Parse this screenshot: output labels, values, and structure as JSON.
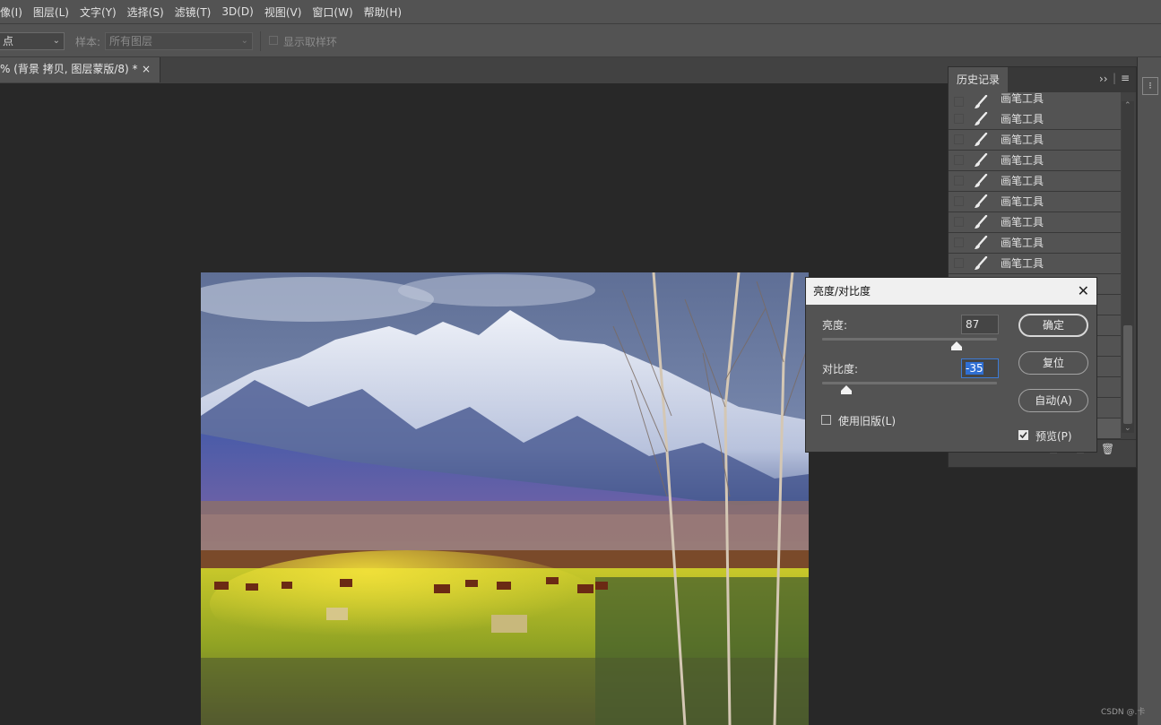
{
  "menu": [
    "像(I)",
    "图层(L)",
    "文字(Y)",
    "选择(S)",
    "滤镜(T)",
    "3D(D)",
    "视图(V)",
    "窗口(W)",
    "帮助(H)"
  ],
  "options": {
    "sample_size_value": "点",
    "sample_label": "样本:",
    "sample_value": "所有图层",
    "show_ring_label": "显示取样环"
  },
  "doc_tab": {
    "title": "% (背景 拷贝, 图层蒙版/8) *",
    "close": "×"
  },
  "history": {
    "tab": "历史记录",
    "items": [
      "画笔工具",
      "画笔工具",
      "画笔工具",
      "画笔工具",
      "画笔工具",
      "画笔工具",
      "画笔工具",
      "画笔工具",
      "画笔工具"
    ]
  },
  "dialog": {
    "title": "亮度/对比度",
    "close": "✕",
    "brightness_label": "亮度:",
    "brightness_value": "87",
    "brightness_level": 0.77,
    "contrast_label": "对比度:",
    "contrast_value": "-35",
    "contrast_level": 0.14,
    "legacy_label": "使用旧版(L)",
    "ok": "确定",
    "reset": "复位",
    "auto": "自动(A)",
    "preview_label": "预览(P)",
    "preview_checked": true
  },
  "watermark": "CSDN @.卡",
  "colors": {
    "panel": "#535353",
    "canvas_bg": "#282828",
    "accent": "#2f6fd3"
  }
}
